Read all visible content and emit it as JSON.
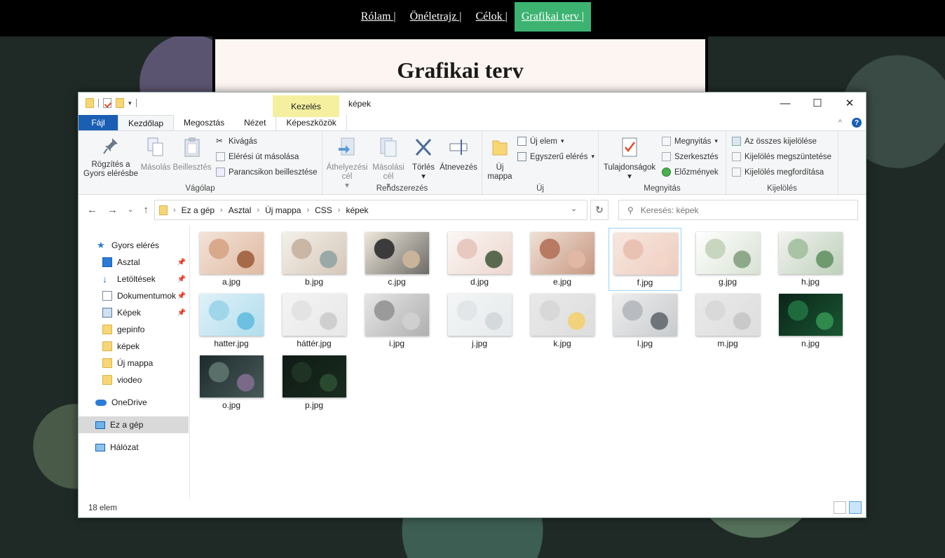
{
  "site": {
    "nav": [
      "Rólam |",
      "Önéletrajz |",
      "Célok |",
      "Grafikai terv |"
    ],
    "active_nav": "Grafikai terv |",
    "title": "Grafikai terv"
  },
  "window": {
    "title": "képek",
    "context_tab": "Kezelés",
    "controls": {
      "minimize": "—",
      "maximize": "☐",
      "close": "✕"
    }
  },
  "tabs": [
    "Fájl",
    "Kezdőlap",
    "Megosztás",
    "Nézet",
    "Képeszközök"
  ],
  "ribbon": {
    "clipboard": {
      "label": "Vágólap",
      "pin": "Rögzítés a Gyors elérésbe",
      "copy": "Másolás",
      "paste": "Beillesztés",
      "cut": "Kivágás",
      "copy_path": "Elérési út másolása",
      "paste_shortcut": "Parancsikon beillesztése"
    },
    "organize": {
      "label": "Rendszerezés",
      "move_to": "Áthelyezési cél",
      "copy_to": "Másolási cél",
      "delete": "Törlés",
      "rename": "Átnevezés"
    },
    "new": {
      "label": "Új",
      "new_folder": "Új mappa",
      "new_item": "Új elem",
      "easy_access": "Egyszerű elérés"
    },
    "open": {
      "label": "Megnyitás",
      "properties": "Tulajdonságok",
      "open": "Megnyitás",
      "edit": "Szerkesztés",
      "history": "Előzmények"
    },
    "select": {
      "label": "Kijelölés",
      "select_all": "Az összes kijelölése",
      "select_none": "Kijelölés megszüntetése",
      "invert": "Kijelölés megfordítása"
    }
  },
  "address": {
    "path": [
      "Ez a gép",
      "Asztal",
      "Új mappa",
      "CSS",
      "képek"
    ],
    "search_placeholder": "Keresés: képek"
  },
  "sidebar": {
    "quick_access": "Gyors elérés",
    "items": [
      "Asztal",
      "Letöltések",
      "Dokumentumok",
      "Képek",
      "gepinfo",
      "képek",
      "Új mappa",
      "viodeo"
    ],
    "onedrive": "OneDrive",
    "this_pc": "Ez a gép",
    "network": "Hálózat"
  },
  "files": [
    {
      "name": "a.jpg",
      "colors": [
        "#f2e3d8",
        "#d9a98c",
        "#a66a4b"
      ]
    },
    {
      "name": "b.jpg",
      "colors": [
        "#f4f1ea",
        "#c9b6a4",
        "#9aa8a8"
      ]
    },
    {
      "name": "c.jpg",
      "colors": [
        "#eee7da",
        "#3b3b3b",
        "#c9b39a"
      ]
    },
    {
      "name": "d.jpg",
      "colors": [
        "#fbf7f4",
        "#e7c9bf",
        "#5a6a50"
      ]
    },
    {
      "name": "e.jpg",
      "colors": [
        "#efe0d4",
        "#b87a62",
        "#e0b8a4"
      ]
    },
    {
      "name": "f.jpg",
      "colors": [
        "#f7e7df",
        "#eac2b3",
        "#f4d6c8"
      ]
    },
    {
      "name": "g.jpg",
      "colors": [
        "#ffffff",
        "#c8d6c0",
        "#8ea88a"
      ]
    },
    {
      "name": "h.jpg",
      "colors": [
        "#f2f2f0",
        "#a8c4a4",
        "#6f9a70"
      ]
    },
    {
      "name": "hatter.jpg",
      "colors": [
        "#dff1f7",
        "#9fd6ea",
        "#6cc0e0"
      ]
    },
    {
      "name": "háttér.jpg",
      "colors": [
        "#f4f4f4",
        "#e3e3e3",
        "#cfcfcf"
      ]
    },
    {
      "name": "i.jpg",
      "colors": [
        "#e6e6e6",
        "#9a9a9a",
        "#cfcfcf"
      ]
    },
    {
      "name": "j.jpg",
      "colors": [
        "#f3f5f6",
        "#e2e6e8",
        "#d4d9dc"
      ]
    },
    {
      "name": "k.jpg",
      "colors": [
        "#e9e9e9",
        "#d8d8d8",
        "#f2d27a"
      ]
    },
    {
      "name": "l.jpg",
      "colors": [
        "#eeeeee",
        "#b8bcc0",
        "#6e747a"
      ]
    },
    {
      "name": "m.jpg",
      "colors": [
        "#e9e9e9",
        "#d9d9d9",
        "#c9c9c9"
      ]
    },
    {
      "name": "n.jpg",
      "colors": [
        "#0b2418",
        "#1f6b3e",
        "#2f8a4c"
      ]
    },
    {
      "name": "o.jpg",
      "colors": [
        "#1d2a2c",
        "#5a6e6a",
        "#7a6a8a"
      ]
    },
    {
      "name": "p.jpg",
      "colors": [
        "#0f1a14",
        "#1e3324",
        "#2a4a30"
      ]
    }
  ],
  "selected_file": "f.jpg",
  "status": {
    "count": "18 elem"
  },
  "colors": {
    "accent": "#1a5fb4",
    "context_tab": "#f5f0a0",
    "site_nav_active": "#3cb371"
  }
}
